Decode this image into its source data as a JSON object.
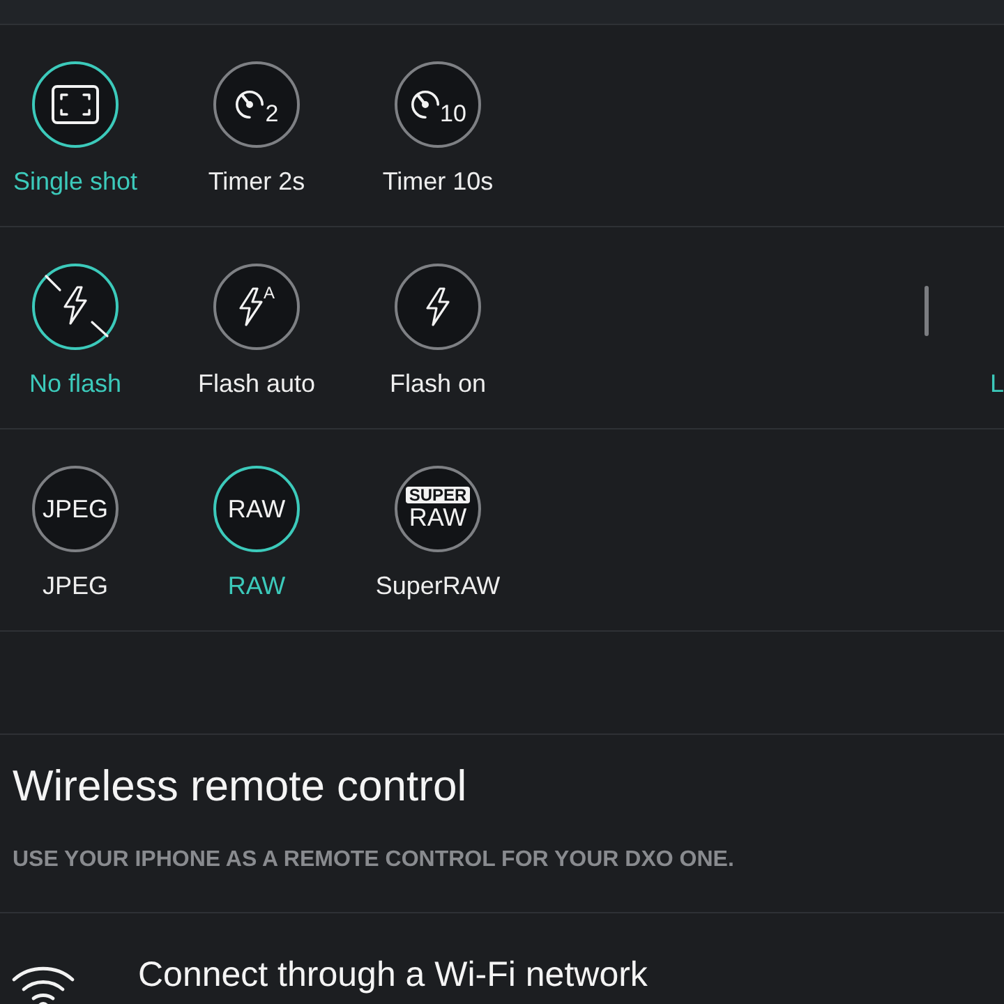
{
  "drive_modes": [
    {
      "label": "Single shot",
      "kind": "frame",
      "selected": true
    },
    {
      "label": "Timer 2s",
      "kind": "timer",
      "icon_text": "2",
      "selected": false
    },
    {
      "label": "Timer 10s",
      "kind": "timer",
      "icon_text": "10",
      "selected": false
    }
  ],
  "flash_modes": [
    {
      "label": "No flash",
      "kind": "flash-off",
      "selected": true
    },
    {
      "label": "Flash auto",
      "kind": "flash",
      "icon_text": "A",
      "selected": false
    },
    {
      "label": "Flash on",
      "kind": "flash",
      "selected": false
    }
  ],
  "flash_side": {
    "label": "L",
    "selected": true
  },
  "file_formats": [
    {
      "label": "JPEG",
      "kind": "format",
      "icon_text": "JPEG",
      "selected": false
    },
    {
      "label": "RAW",
      "kind": "format",
      "icon_text": "RAW",
      "selected": true
    },
    {
      "label": "SuperRAW",
      "kind": "format",
      "icon_tag": "SUPER",
      "icon_text": "RAW",
      "selected": false
    }
  ],
  "wireless_section": {
    "title": "Wireless remote control",
    "description": "USE YOUR IPHONE AS A REMOTE CONTROL FOR YOUR DXO ONE.",
    "items": [
      {
        "label": "Connect through a Wi-Fi network",
        "kind": "wifi"
      }
    ]
  }
}
